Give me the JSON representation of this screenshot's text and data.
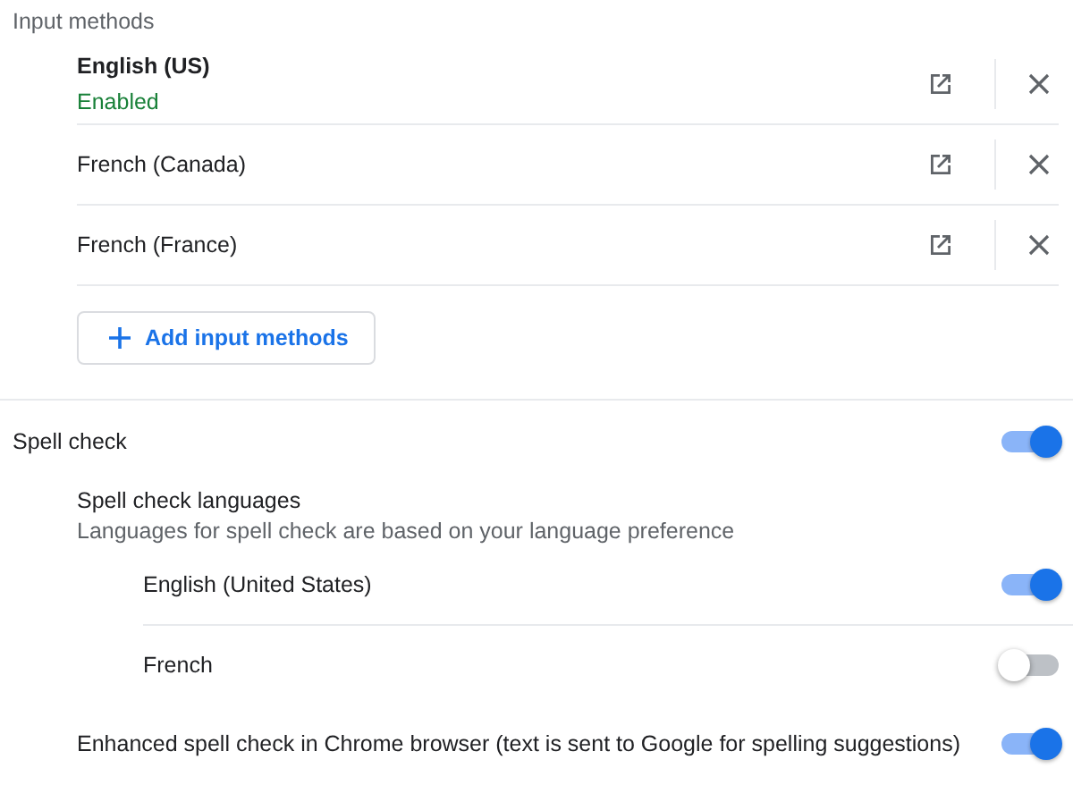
{
  "input_methods": {
    "title": "Input methods",
    "items": [
      {
        "name": "English (US)",
        "active": true,
        "status": "Enabled"
      },
      {
        "name": "French (Canada)",
        "active": false
      },
      {
        "name": "French (France)",
        "active": false
      }
    ],
    "add_button": "Add input methods"
  },
  "spell_check": {
    "label": "Spell check",
    "on": true
  },
  "spell_check_languages": {
    "title": "Spell check languages",
    "subtitle": "Languages for spell check are based on your language preference",
    "items": [
      {
        "name": "English (United States)",
        "on": true
      },
      {
        "name": "French",
        "on": false
      }
    ]
  },
  "enhanced_spell_check": {
    "label": "Enhanced spell check in Chrome browser (text is sent to Google for spelling suggestions)",
    "on": true
  }
}
